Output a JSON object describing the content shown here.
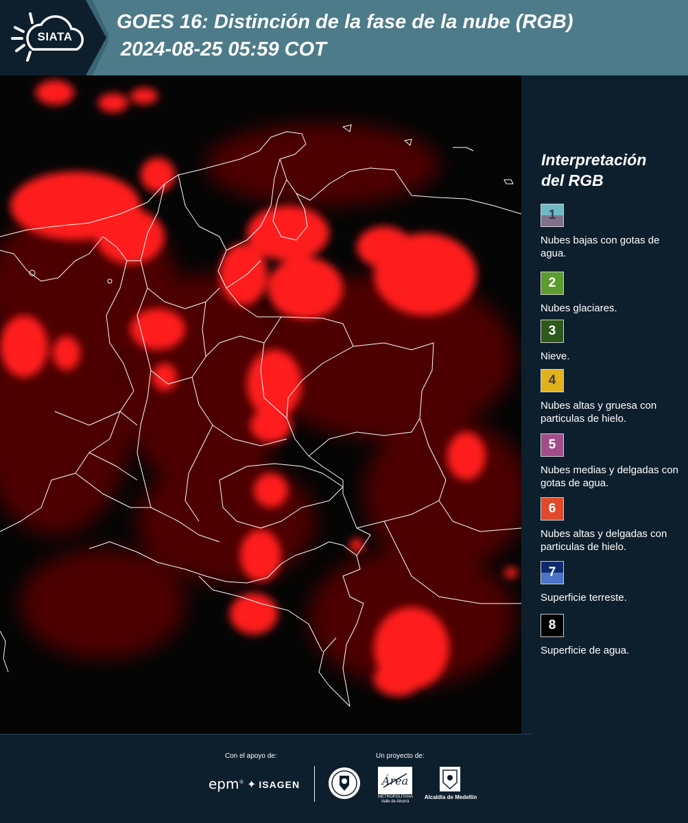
{
  "header": {
    "brand": "SIATA",
    "title_line1": "GOES 16: Distinción de la fase de la nube (RGB)",
    "title_line2": "2024-08-25 05:59 COT",
    "background_color": "#4d7b89"
  },
  "map": {
    "background_color": "#050505",
    "cloud_color": "#ff1a1a",
    "border_color": "#ffffff"
  },
  "legend": {
    "title_line1": "Interpretación",
    "title_line2": "del RGB",
    "items": [
      {
        "number": "1",
        "label": "Nubes bajas con gotas de agua.",
        "color_top": "#6fb9c7",
        "color_bottom": "#7e7189",
        "number_color": "#3a3a4a"
      },
      {
        "number": "2",
        "label": "Nubes glaciares.",
        "color_top": "#5c9b2d",
        "color_bottom": "#5c9b2d",
        "number_color": "#ffffff"
      },
      {
        "number": "3",
        "label": "Nieve.",
        "color_top": "#2d5a1c",
        "color_bottom": "#2d5a1c",
        "number_color": "#ffffff"
      },
      {
        "number": "4",
        "label": "Nubes altas y gruesa con particulas de hielo.",
        "color_top": "#e2b21d",
        "color_bottom": "#e2b21d",
        "number_color": "#3a3a4a"
      },
      {
        "number": "5",
        "label": "Nubes medias y delgadas con gotas de agua.",
        "color_top": "#a24d8a",
        "color_bottom": "#a24d8a",
        "number_color": "#ffffff"
      },
      {
        "number": "6",
        "label": "Nubes altas y delgadas con particulas de hielo.",
        "color_top": "#e0492a",
        "color_bottom": "#e0492a",
        "number_color": "#ffffff"
      },
      {
        "number": "7",
        "label": "Superficie terreste.",
        "color_top": "#0e2a6e",
        "color_bottom": "#4a73c9",
        "number_color": "#ffffff"
      },
      {
        "number": "8",
        "label": "Superficie de agua.",
        "color_top": "#000000",
        "color_bottom": "#000000",
        "number_color": "#ffffff"
      }
    ]
  },
  "footer": {
    "support_label": "Con el apoyo de:",
    "project_label": "Un proyecto de:",
    "epm": "epm",
    "isagen": "ISAGEN",
    "amva_line1": "METROPOLITANA",
    "amva_line2": "Valle de Aburrá",
    "amva_script": "Área",
    "medellin": "Alcaldía de Medellín"
  }
}
